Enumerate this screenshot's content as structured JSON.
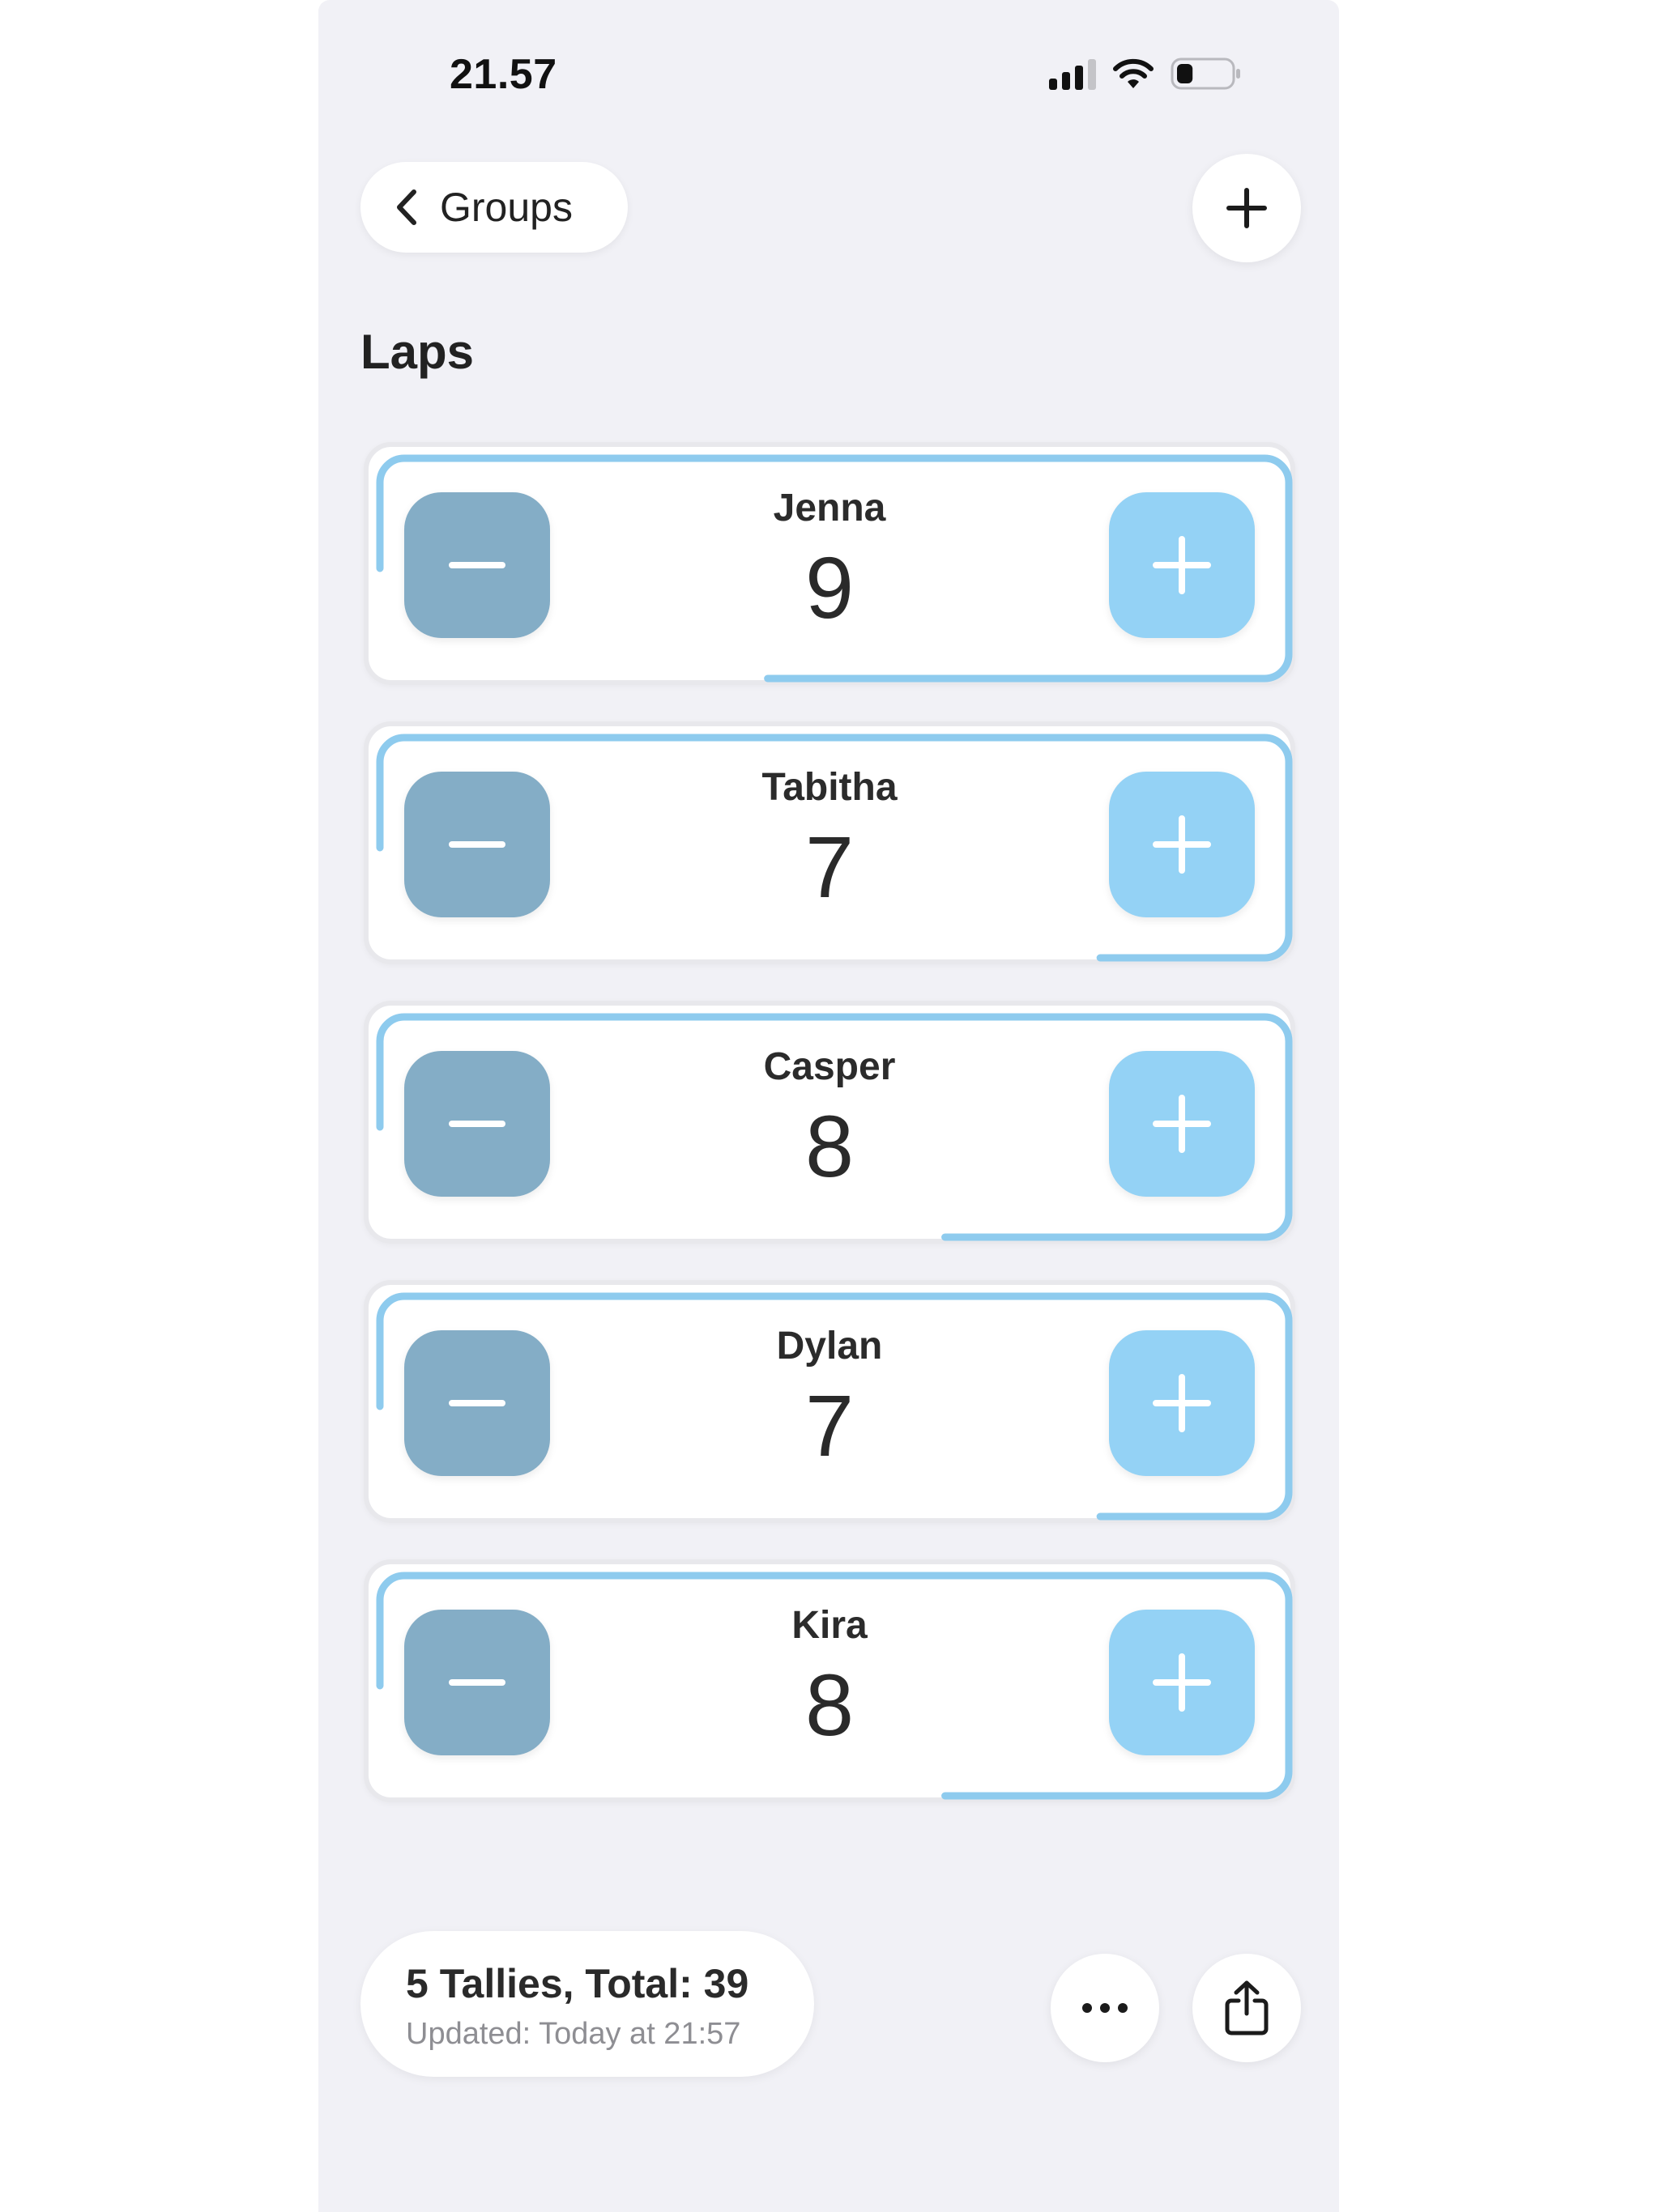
{
  "status_bar": {
    "time": "21.57",
    "icons": [
      "cellular-signal-icon",
      "wifi-icon",
      "battery-icon"
    ],
    "battery_level": 0.3
  },
  "header": {
    "back_label": "Groups",
    "back_icon": "chevron-left-icon",
    "add_icon": "plus-icon"
  },
  "page": {
    "title": "Laps"
  },
  "tallies": [
    {
      "name": "Jenna",
      "count": "9",
      "progress": 0.78
    },
    {
      "name": "Tabitha",
      "count": "7",
      "progress": 0.63
    },
    {
      "name": "Casper",
      "count": "8",
      "progress": 0.7
    },
    {
      "name": "Dylan",
      "count": "7",
      "progress": 0.63
    },
    {
      "name": "Kira",
      "count": "8",
      "progress": 0.7
    }
  ],
  "footer": {
    "summary": "5 Tallies, Total: 39",
    "updated": "Updated: Today at 21:57",
    "more_icon": "ellipsis-icon",
    "share_icon": "share-icon"
  },
  "colors": {
    "background": "#f1f1f6",
    "minus_button": "#84adc6",
    "plus_button": "#94d2f5",
    "progress_ring": "#8ecbee",
    "track": "#e8e8ec"
  }
}
